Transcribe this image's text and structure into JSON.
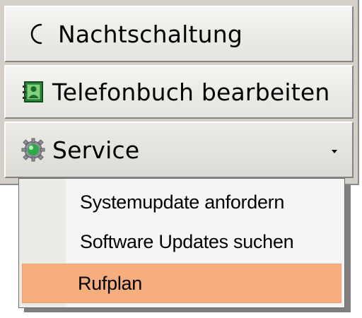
{
  "panel": {
    "buttons": [
      {
        "label": "Nachtschaltung",
        "icon": "moon-icon"
      },
      {
        "label": "Telefonbuch bearbeiten",
        "icon": "phonebook-icon"
      },
      {
        "label": "Service",
        "icon": "service-gear-icon",
        "has_dropdown": true
      }
    ]
  },
  "menu": {
    "items": [
      {
        "label": "Systemupdate anfordern",
        "highlighted": false
      },
      {
        "label": "Software Updates suchen",
        "highlighted": false
      },
      {
        "label": "Rufplan",
        "highlighted": true
      }
    ]
  },
  "colors": {
    "panel_bg": "#d4d0c8",
    "menu_bg": "#f5f5f5",
    "highlight": "#f7ae7e",
    "moon": "#f0e000"
  }
}
